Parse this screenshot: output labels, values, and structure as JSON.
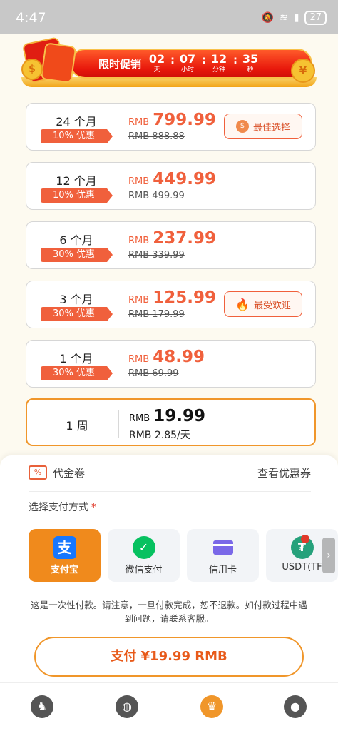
{
  "status": {
    "time": "4:47",
    "battery": "27"
  },
  "promo": {
    "label": "限时促销",
    "countdown": [
      {
        "value": "02",
        "unit": "天"
      },
      {
        "value": "07",
        "unit": "小时"
      },
      {
        "value": "12",
        "unit": "分钟"
      },
      {
        "value": "35",
        "unit": "秒"
      }
    ]
  },
  "plans": [
    {
      "months": "24 个月",
      "discount": "10% 优惠",
      "currency": "RMB",
      "price": "799.99",
      "old_price": "RMB 888.88",
      "badge": "最佳选择",
      "badge_icon": "medal-icon"
    },
    {
      "months": "12 个月",
      "discount": "10% 优惠",
      "currency": "RMB",
      "price": "449.99",
      "old_price": "RMB 499.99"
    },
    {
      "months": "6 个月",
      "discount": "30% 优惠",
      "currency": "RMB",
      "price": "237.99",
      "old_price": "RMB 339.99"
    },
    {
      "months": "3 个月",
      "discount": "30% 优惠",
      "currency": "RMB",
      "price": "125.99",
      "old_price": "RMB 179.99",
      "badge": "最受欢迎",
      "badge_icon": "flame-icon"
    },
    {
      "months": "1 个月",
      "discount": "30% 优惠",
      "currency": "RMB",
      "price": "48.99",
      "old_price": "RMB 69.99"
    },
    {
      "months": "1 周",
      "currency": "RMB",
      "price": "19.99",
      "per_day": "RMB 2.85/天",
      "selected": true
    }
  ],
  "coupon": {
    "label": "代金卷",
    "link": "查看优惠券"
  },
  "payment": {
    "title": "选择支付方式",
    "required_mark": "*",
    "methods": [
      {
        "label": "支付宝",
        "icon": "alipay-icon",
        "active": true
      },
      {
        "label": "微信支付",
        "icon": "wechat-pay-icon"
      },
      {
        "label": "信用卡",
        "icon": "credit-card-icon"
      },
      {
        "label": "USDT(TF",
        "icon": "usdt-icon"
      }
    ],
    "notice": "这是一次性付款。请注意，一旦付款完成，恕不退款。如付款过程中遇到问题，请联系客服。",
    "pay_button": "支付 ¥19.99 RMB"
  },
  "tabs": [
    {
      "name": "home-tab",
      "icon": "mascot-icon"
    },
    {
      "name": "globe-tab",
      "icon": "globe-icon"
    },
    {
      "name": "vip-tab",
      "icon": "crown-icon",
      "active": true
    },
    {
      "name": "profile-tab",
      "icon": "user-icon"
    }
  ],
  "colors": {
    "accent": "#f0962a",
    "discount": "#f0603c",
    "alipay": "#f08a1c"
  }
}
